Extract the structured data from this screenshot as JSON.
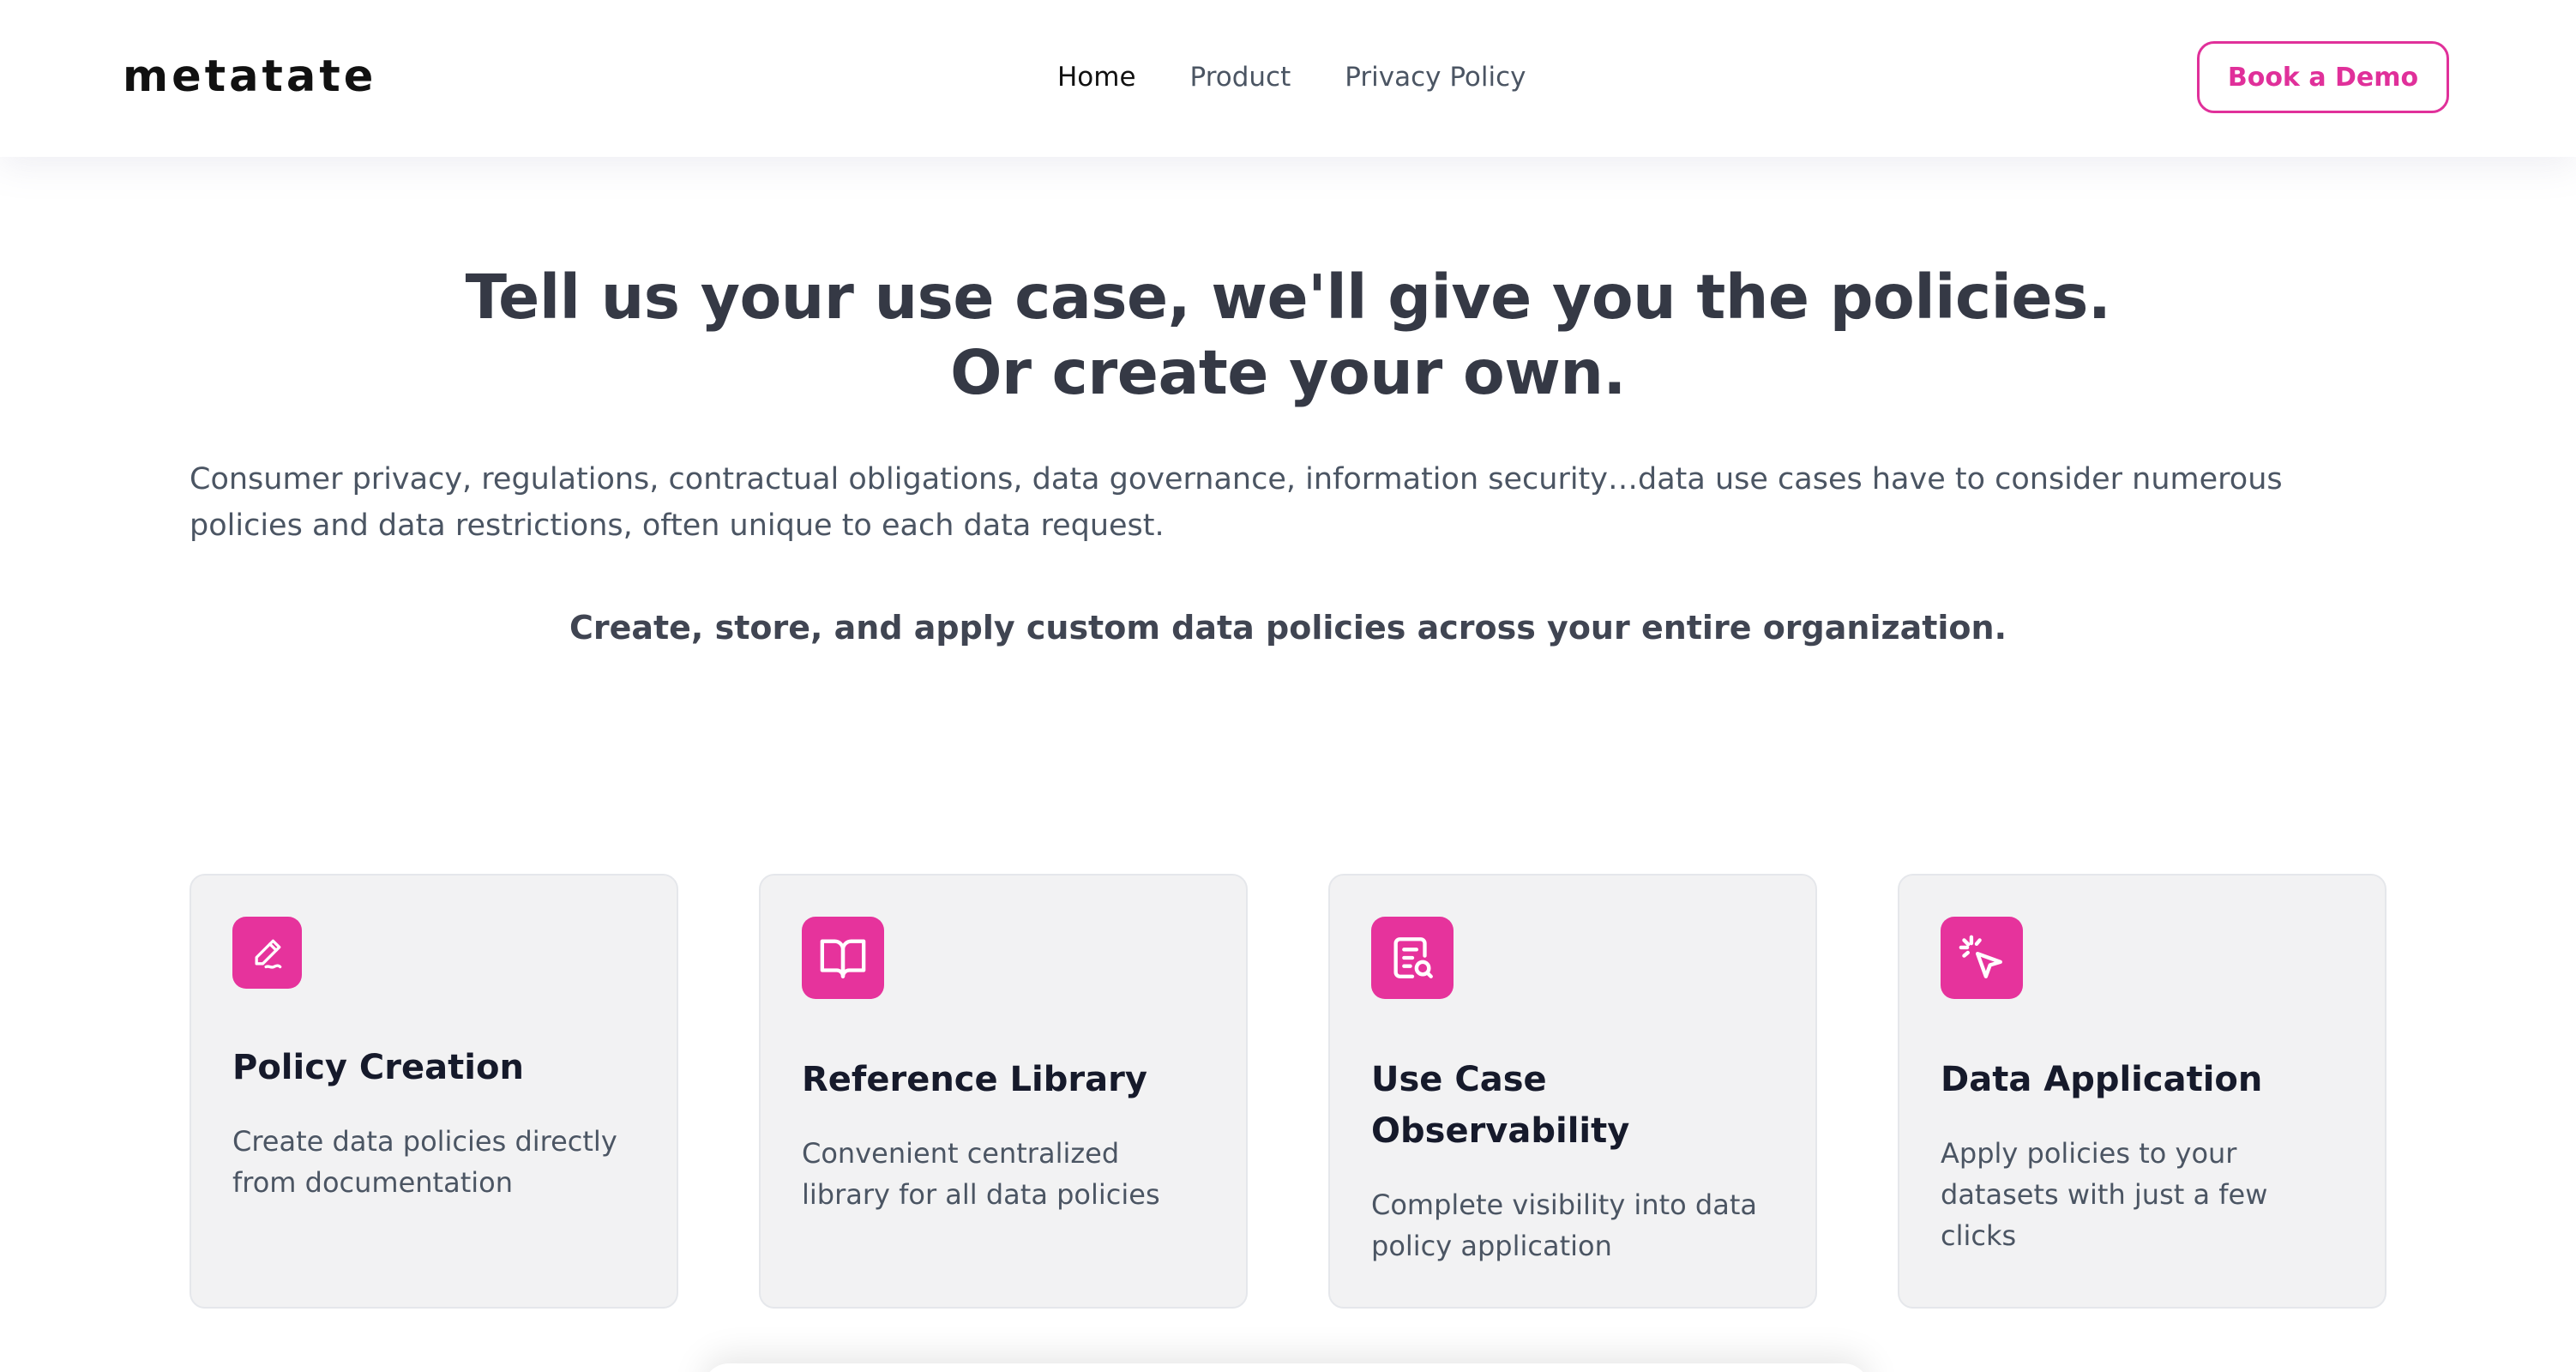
{
  "header": {
    "logo": "metatate",
    "nav": [
      {
        "label": "Home"
      },
      {
        "label": "Product"
      },
      {
        "label": "Privacy Policy"
      }
    ],
    "cta_label": "Book a Demo"
  },
  "hero": {
    "title_line1": "Tell us your use case, we'll give you the policies.",
    "title_line2": "Or create your own.",
    "description": "Consumer privacy, regulations, contractual obligations, data governance, information security…data use cases have to consider numerous policies and data restrictions, often unique to each data request.",
    "subheading": "Create, store, and apply custom data policies across your entire organization."
  },
  "features": [
    {
      "icon": "pen-icon",
      "title": "Policy Creation",
      "description": "Create data policies directly from documentation"
    },
    {
      "icon": "book-open-icon",
      "title": "Reference Library",
      "description": "Convenient centralized library for all data policies"
    },
    {
      "icon": "file-search-icon",
      "title": "Use Case Observability",
      "description": "Complete visibility into data policy application"
    },
    {
      "icon": "cursor-click-icon",
      "title": "Data Application",
      "description": "Apply policies to your datasets with just a few clicks"
    }
  ],
  "colors": {
    "accent": "#e6339c",
    "heading": "#353945",
    "card_bg": "#f2f2f3"
  }
}
